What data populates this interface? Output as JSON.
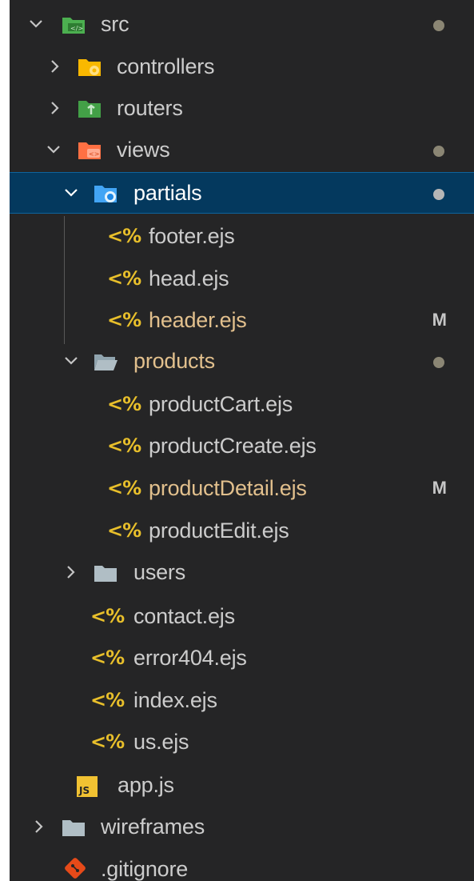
{
  "tree": {
    "src": {
      "label": "src"
    },
    "controllers": {
      "label": "controllers"
    },
    "routers": {
      "label": "routers"
    },
    "views": {
      "label": "views"
    },
    "partials": {
      "label": "partials"
    },
    "footer": {
      "label": "footer.ejs"
    },
    "head": {
      "label": "head.ejs"
    },
    "header": {
      "label": "header.ejs",
      "badge": "M"
    },
    "products": {
      "label": "products"
    },
    "productCart": {
      "label": "productCart.ejs"
    },
    "productCreate": {
      "label": "productCreate.ejs"
    },
    "productDetail": {
      "label": "productDetail.ejs",
      "badge": "M"
    },
    "productEdit": {
      "label": "productEdit.ejs"
    },
    "users": {
      "label": "users"
    },
    "contact": {
      "label": "contact.ejs"
    },
    "error404": {
      "label": "error404.ejs"
    },
    "index": {
      "label": "index.ejs"
    },
    "us": {
      "label": "us.ejs"
    },
    "app": {
      "label": "app.js",
      "icon_text": "JS"
    },
    "wireframes": {
      "label": "wireframes"
    },
    "gitignore": {
      "label": ".gitignore"
    }
  },
  "ejs_icon_text": "<%",
  "colors": {
    "background": "#252526",
    "selected_row": "#04395e",
    "modified_text": "#e2c08d",
    "ejs_icon": "#e8bf2b"
  }
}
